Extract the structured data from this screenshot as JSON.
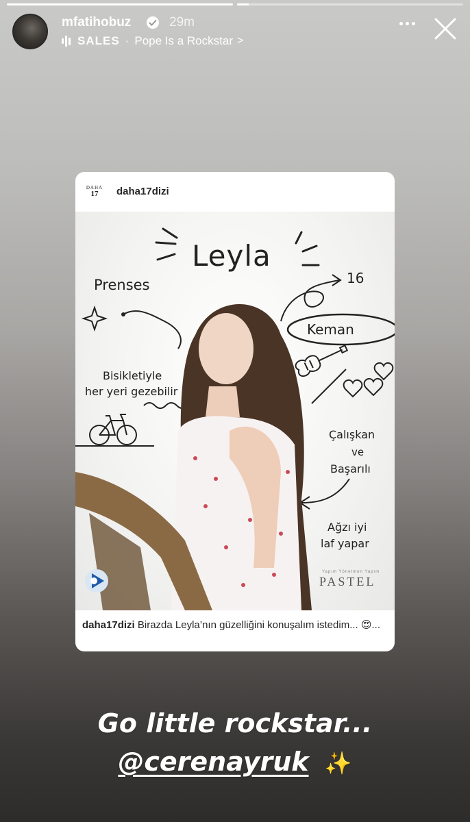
{
  "story": {
    "progress": [
      1.0,
      0.05
    ]
  },
  "header": {
    "username": "mfatihobuz",
    "time": "29m",
    "music": {
      "label": "SALES",
      "separator": "·",
      "song": "Pope Is a Rockstar",
      "chevron": ">"
    }
  },
  "card": {
    "logo_top": "DAHA",
    "logo_bottom": "17",
    "account": "daha17dizi",
    "image_text": {
      "name": "Leyla",
      "prenses": "Prenses",
      "age": "16",
      "keman": "Keman",
      "bisiklet_1": "Bisikletiyle",
      "bisiklet_2": "her yeri gezebilir",
      "caliskan": "Çalışkan",
      "ve": "ve",
      "basarili": "Başarılı",
      "agzi": "Ağzı iyi",
      "laf": "laf yapar",
      "studio_small": "Yapım Yönetmen Yapım",
      "studio": "PASTEL"
    },
    "caption_user": "daha17dizi",
    "caption_text": "Birazda Leyla’nın güzelliğini konuşalım istedim... 😍..."
  },
  "story_text": {
    "line1": "Go little rockstar...",
    "mention": "@cerenayruk",
    "emoji": "✨"
  }
}
